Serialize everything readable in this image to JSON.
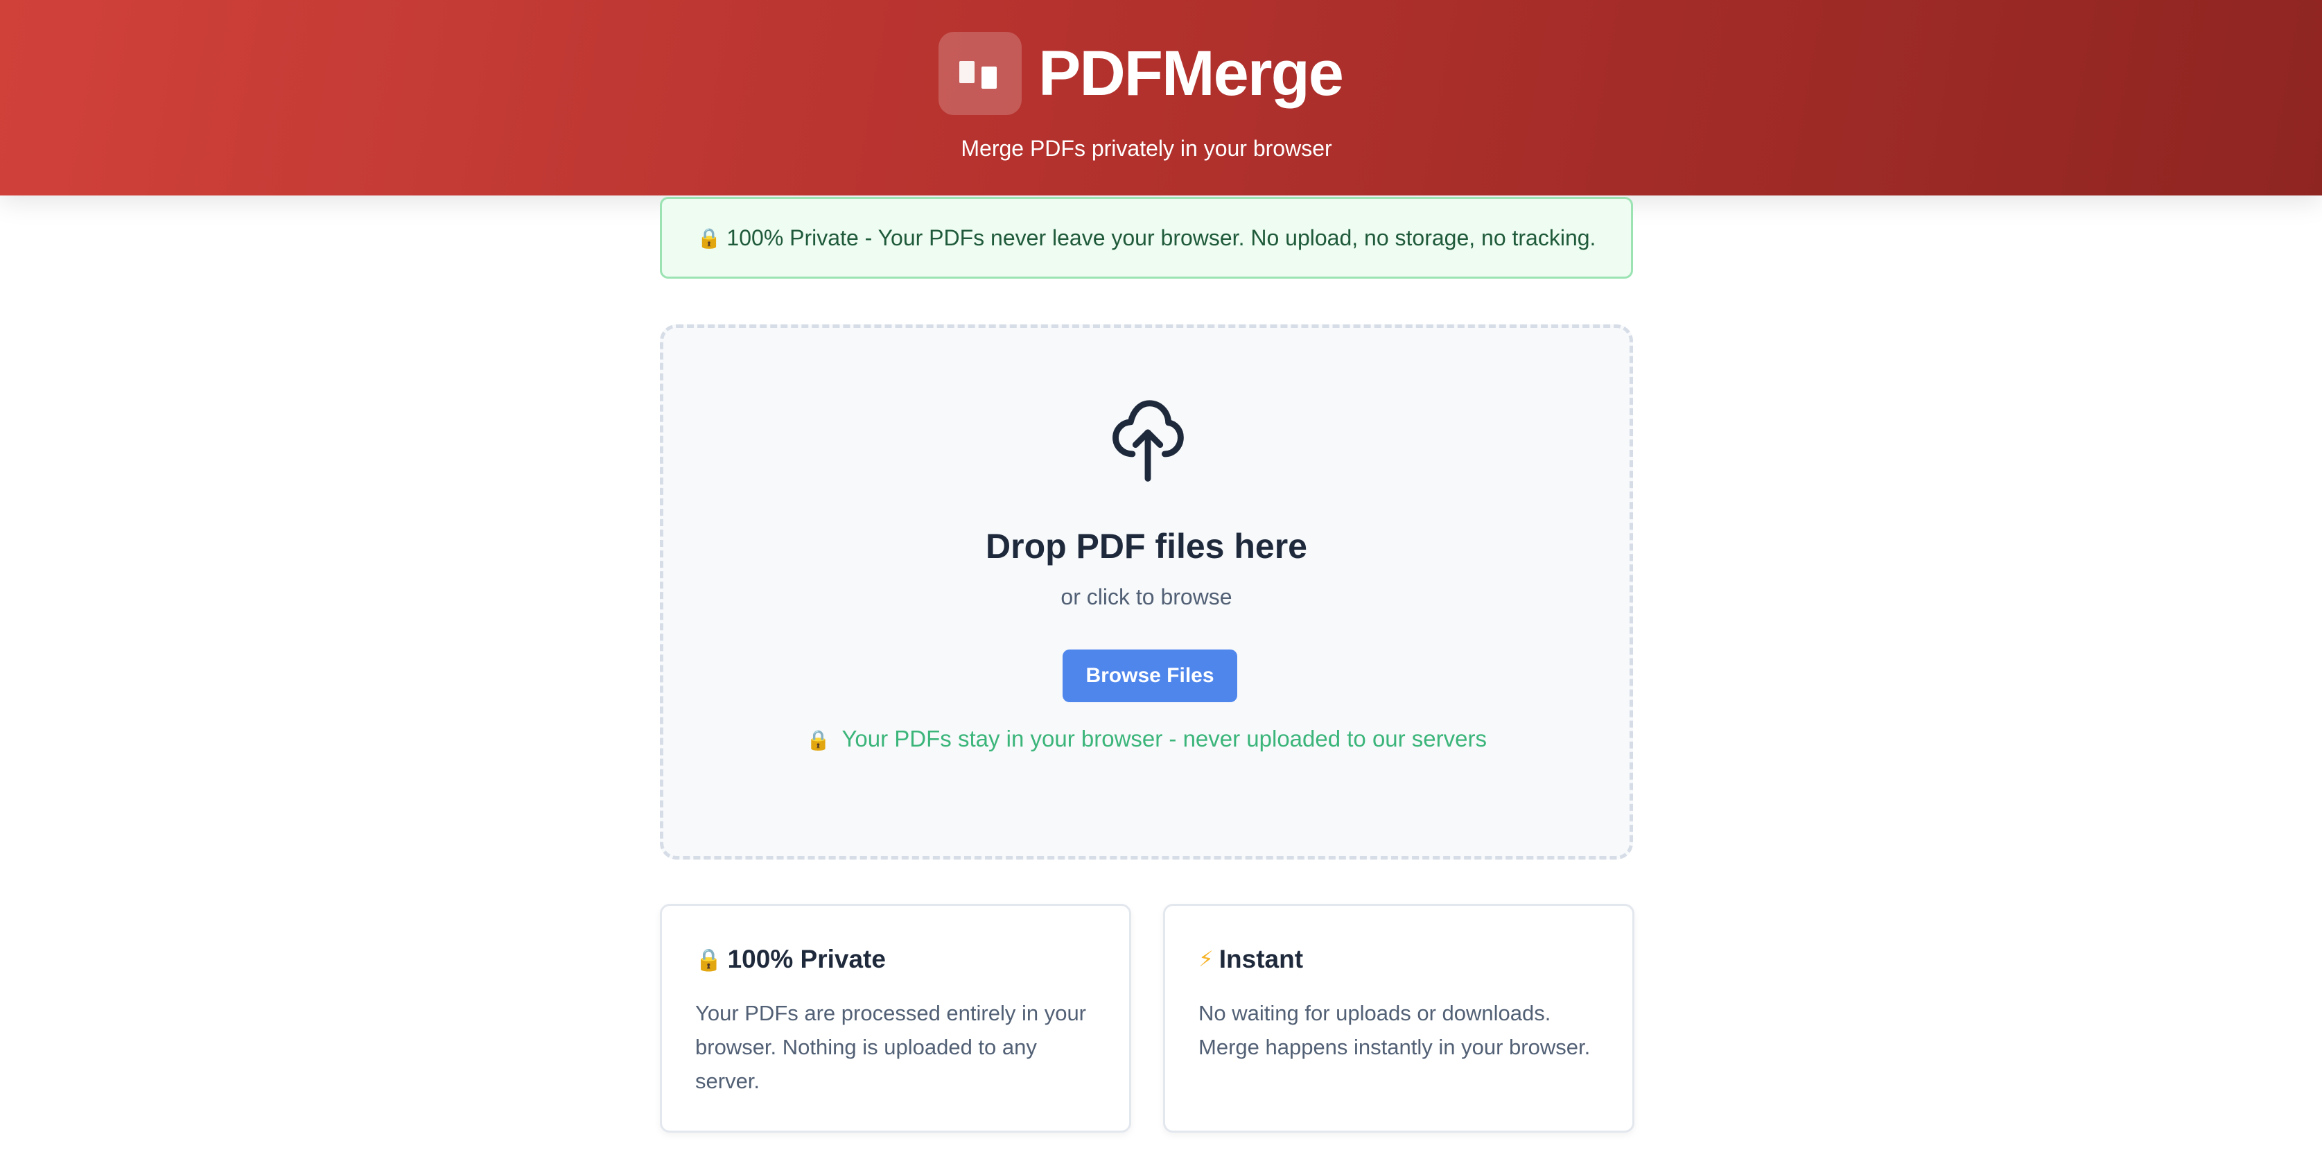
{
  "header": {
    "brand": "PDFMerge",
    "logo_icon": "merge-pages-icon",
    "tagline": "Merge PDFs privately in your browser"
  },
  "banner": {
    "icon": "lock-icon",
    "text": "100% Private - Your PDFs never leave your browser. No upload, no storage, no tracking."
  },
  "dropzone": {
    "icon": "cloud-upload-icon",
    "title": "Drop PDF files here",
    "subtitle": "or click to browse",
    "button_label": "Browse Files",
    "note_icon": "lock-icon",
    "note": "Your PDFs stay in your browser - never uploaded to our servers"
  },
  "features": [
    {
      "icon": "lock-icon",
      "title": "100% Private",
      "text": "Your PDFs are processed entirely in your browser. Nothing is uploaded to any server."
    },
    {
      "icon": "lightning-icon",
      "title": "Instant",
      "text": "No waiting for uploads or downloads. Merge happens instantly in your browser."
    }
  ],
  "colors": {
    "header_start": "#d0413a",
    "header_end": "#8f2521",
    "banner_bg": "#eefcf2",
    "banner_border": "#9be3b3",
    "primary_button": "#4f86ec",
    "note_green": "#3bb57a"
  }
}
